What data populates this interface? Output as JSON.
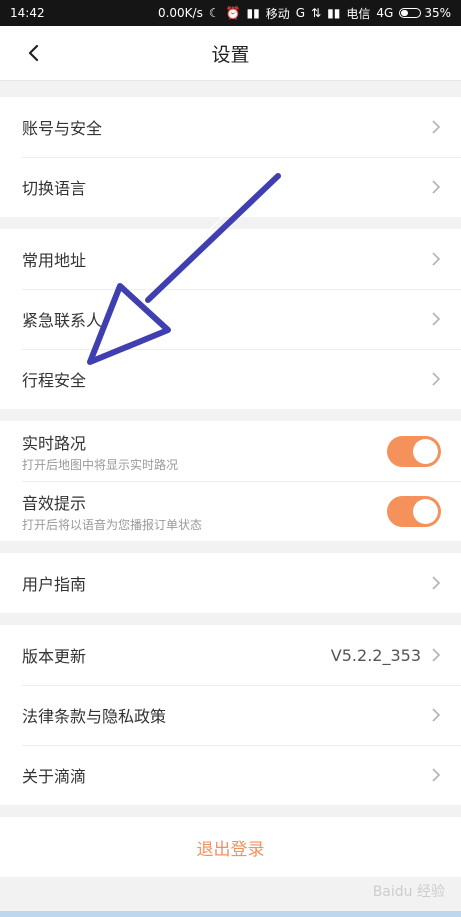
{
  "status_bar": {
    "time": "14:42",
    "net_speed": "0.00K/s",
    "carrier1": "移动",
    "carrier1_net": "G",
    "carrier2": "电信",
    "carrier2_net": "4G",
    "battery_percent": "35%",
    "battery_level": 0.35
  },
  "header": {
    "title": "设置"
  },
  "sections": {
    "account": {
      "rows": [
        {
          "label": "账号与安全"
        },
        {
          "label": "切换语言"
        }
      ]
    },
    "safety": {
      "rows": [
        {
          "label": "常用地址"
        },
        {
          "label": "紧急联系人"
        },
        {
          "label": "行程安全"
        }
      ]
    },
    "toggles": {
      "rows": [
        {
          "title": "实时路况",
          "subtitle": "打开后地图中将显示实时路况",
          "on": true
        },
        {
          "title": "音效提示",
          "subtitle": "打开后将以语音为您播报订单状态",
          "on": true
        }
      ]
    },
    "guide": {
      "rows": [
        {
          "label": "用户指南"
        }
      ]
    },
    "about": {
      "rows": [
        {
          "label": "版本更新",
          "value": "V5.2.2_353"
        },
        {
          "label": "法律条款与隐私政策"
        },
        {
          "label": "关于滴滴"
        }
      ]
    }
  },
  "logout": {
    "label": "退出登录"
  },
  "watermark": {
    "text": "Baidu 经验"
  },
  "colors": {
    "accent": "#f5915a",
    "toggle_on": "#f5915a",
    "arrow": "#3f3fb0"
  },
  "icons": {
    "back": "chevron-left-icon",
    "row_chevron": "chevron-right-icon"
  }
}
